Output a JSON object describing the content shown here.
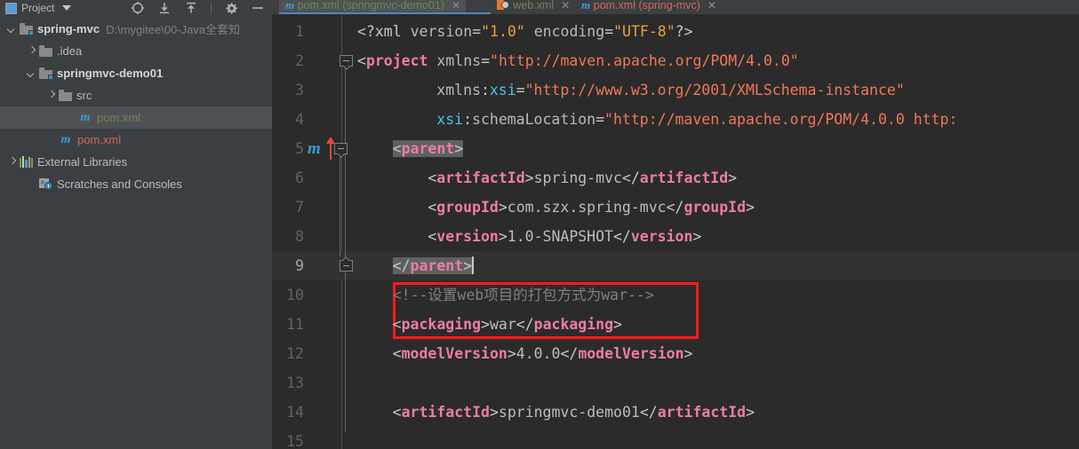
{
  "window": {
    "app": "IntelliJ IDEA",
    "theme_bg": "#2b2b2b",
    "panel_bg": "#3c3f41",
    "accent": "#4a88c7",
    "highlight_box_color": "#ff1a1a"
  },
  "project_panel": {
    "toolbar": {
      "title": "Project",
      "dropdown_icon": "chevron-down-icon",
      "icons": [
        {
          "name": "locate-target-icon",
          "tooltip": "Select Opened File"
        },
        {
          "name": "collapse-all-icon",
          "tooltip": "Collapse All"
        },
        {
          "name": "expand-all-icon",
          "tooltip": "Expand All"
        },
        {
          "name": "settings-gear-icon",
          "tooltip": "Settings"
        },
        {
          "name": "hide-minimize-icon",
          "tooltip": "Hide"
        }
      ]
    },
    "tree": [
      {
        "id": "spring-mvc",
        "label": "spring-mvc",
        "path": "D:\\mygitee\\00-Java全套知",
        "icon": "module-folder-icon",
        "arrow": "down",
        "indent": 0,
        "bold": true,
        "color": "#d6d6d6",
        "selected": false
      },
      {
        "id": "idea",
        "label": ".idea",
        "path": "",
        "icon": "folder-icon",
        "arrow": "right",
        "indent": 1,
        "bold": false,
        "color": "#bbbbbb",
        "selected": false
      },
      {
        "id": "springmvc-demo01",
        "label": "springmvc-demo01",
        "path": "",
        "icon": "module-folder-icon",
        "arrow": "down",
        "indent": 1,
        "bold": true,
        "color": "#d6d6d6",
        "selected": false
      },
      {
        "id": "src",
        "label": "src",
        "path": "",
        "icon": "folder-icon",
        "arrow": "right",
        "indent": 2,
        "bold": false,
        "color": "#bbbbbb",
        "selected": false
      },
      {
        "id": "pom-demo01",
        "label": "pom.xml",
        "path": "",
        "icon": "maven-pom-icon",
        "arrow": "none",
        "indent": 3,
        "bold": false,
        "color": "#6a8759",
        "selected": true
      },
      {
        "id": "pom-root",
        "label": "pom.xml",
        "path": "",
        "icon": "maven-pom-icon",
        "arrow": "none",
        "indent": 2,
        "bold": false,
        "color": "#d2685f",
        "selected": false
      },
      {
        "id": "external-libraries",
        "label": "External Libraries",
        "path": "",
        "icon": "books-library-icon",
        "arrow": "right",
        "indent": 0,
        "bold": false,
        "color": "#bbbbbb",
        "selected": false
      },
      {
        "id": "scratches",
        "label": "Scratches and Consoles",
        "path": "",
        "icon": "scratches-console-icon",
        "arrow": "none",
        "indent": 1,
        "bold": false,
        "color": "#bbbbbb",
        "selected": false
      }
    ]
  },
  "editor": {
    "tabs": [
      {
        "label": "pom.xml (springmvc-demo01)",
        "icon": "maven-pom-icon",
        "color": "#6a8759",
        "active": true,
        "close_icon": "close-icon",
        "close_glyph": "✕"
      },
      {
        "label": "web.xml",
        "icon": "web-descriptor-icon",
        "color": "#6a8759",
        "active": false,
        "close_icon": "close-icon",
        "close_glyph": "✕"
      },
      {
        "label": "pom.xml (spring-mvc)",
        "icon": "maven-pom-icon",
        "color": "#d2685f",
        "active": false,
        "close_icon": "close-icon",
        "close_glyph": "✕"
      }
    ],
    "gutter": {
      "line_numbers": [
        "1",
        "2",
        "3",
        "4",
        "5",
        "6",
        "7",
        "8",
        "9",
        "10",
        "11",
        "12",
        "13",
        "14",
        "15"
      ],
      "current_line": 9,
      "maven_marker": {
        "line": 5,
        "glyph": "m",
        "color": "#3d9ad6"
      },
      "change_arrow": {
        "line": 5,
        "icon": "red-up-arrow-icon",
        "color": "#e04a3f"
      },
      "fold_markers": [
        {
          "line": 2,
          "type": "collapse"
        },
        {
          "line": 5,
          "type": "collapse"
        },
        {
          "line": 9,
          "type": "fold-end"
        }
      ]
    },
    "annotation_box": {
      "color": "#ff1a1a",
      "covers_lines": [
        10,
        11
      ]
    },
    "code": [
      {
        "line": 1,
        "segments": [
          {
            "t": "<?xml ",
            "c": "punct"
          },
          {
            "t": "version",
            "c": "attr"
          },
          {
            "t": "=",
            "c": "punct"
          },
          {
            "t": "\"1.0\"",
            "c": "str"
          },
          {
            "t": " ",
            "c": "punct"
          },
          {
            "t": "encoding",
            "c": "attr"
          },
          {
            "t": "=",
            "c": "punct"
          },
          {
            "t": "\"UTF-8\"",
            "c": "str"
          },
          {
            "t": "?>",
            "c": "punct"
          }
        ]
      },
      {
        "line": 2,
        "segments": [
          {
            "t": "<",
            "c": "punct"
          },
          {
            "t": "project",
            "c": "tagname"
          },
          {
            "t": " ",
            "c": "punct"
          },
          {
            "t": "xmlns",
            "c": "attr"
          },
          {
            "t": "=",
            "c": "punct"
          },
          {
            "t": "\"http://maven.apache.org/POM/4.0.0\"",
            "c": "redstr"
          }
        ]
      },
      {
        "line": 3,
        "indent": 9,
        "segments": [
          {
            "t": "xmlns",
            "c": "attr"
          },
          {
            "t": ":",
            "c": "punct"
          },
          {
            "t": "xsi",
            "c": "ns"
          },
          {
            "t": "=",
            "c": "punct"
          },
          {
            "t": "\"http://www.w3.org/2001/XMLSchema-instance\"",
            "c": "redstr"
          }
        ]
      },
      {
        "line": 4,
        "indent": 9,
        "segments": [
          {
            "t": "xsi",
            "c": "ns"
          },
          {
            "t": ":",
            "c": "punct"
          },
          {
            "t": "schemaLocation",
            "c": "attr"
          },
          {
            "t": "=",
            "c": "punct"
          },
          {
            "t": "\"http://maven.apache.org/POM/4.0.0 http:",
            "c": "redstr"
          }
        ]
      },
      {
        "line": 5,
        "indent": 4,
        "highlight": true,
        "segments": [
          {
            "t": "<",
            "c": "punct"
          },
          {
            "t": "parent",
            "c": "tagname"
          },
          {
            "t": ">",
            "c": "punct"
          }
        ]
      },
      {
        "line": 6,
        "indent": 8,
        "segments": [
          {
            "t": "<",
            "c": "punct"
          },
          {
            "t": "artifactId",
            "c": "tagname"
          },
          {
            "t": ">",
            "c": "punct"
          },
          {
            "t": "spring-mvc",
            "c": "val"
          },
          {
            "t": "</",
            "c": "punct"
          },
          {
            "t": "artifactId",
            "c": "tagname"
          },
          {
            "t": ">",
            "c": "punct"
          }
        ]
      },
      {
        "line": 7,
        "indent": 8,
        "segments": [
          {
            "t": "<",
            "c": "punct"
          },
          {
            "t": "groupId",
            "c": "tagname"
          },
          {
            "t": ">",
            "c": "punct"
          },
          {
            "t": "com.szx.spring-mvc",
            "c": "val"
          },
          {
            "t": "</",
            "c": "punct"
          },
          {
            "t": "groupId",
            "c": "tagname"
          },
          {
            "t": ">",
            "c": "punct"
          }
        ]
      },
      {
        "line": 8,
        "indent": 8,
        "segments": [
          {
            "t": "<",
            "c": "punct"
          },
          {
            "t": "version",
            "c": "tagname"
          },
          {
            "t": ">",
            "c": "punct"
          },
          {
            "t": "1.0-SNAPSHOT",
            "c": "val"
          },
          {
            "t": "</",
            "c": "punct"
          },
          {
            "t": "version",
            "c": "tagname"
          },
          {
            "t": ">",
            "c": "punct"
          }
        ]
      },
      {
        "line": 9,
        "indent": 4,
        "highlight": true,
        "caret": true,
        "segments": [
          {
            "t": "</",
            "c": "punct"
          },
          {
            "t": "parent",
            "c": "tagname"
          },
          {
            "t": ">",
            "c": "punct"
          }
        ]
      },
      {
        "line": 10,
        "indent": 4,
        "segments": [
          {
            "t": "<!--设置web项目的打包方式为war-->",
            "c": "comment"
          }
        ]
      },
      {
        "line": 11,
        "indent": 4,
        "segments": [
          {
            "t": "<",
            "c": "punct"
          },
          {
            "t": "packaging",
            "c": "tagname"
          },
          {
            "t": ">",
            "c": "punct"
          },
          {
            "t": "war",
            "c": "val"
          },
          {
            "t": "</",
            "c": "punct"
          },
          {
            "t": "packaging",
            "c": "tagname"
          },
          {
            "t": ">",
            "c": "punct"
          }
        ]
      },
      {
        "line": 12,
        "indent": 4,
        "segments": [
          {
            "t": "<",
            "c": "punct"
          },
          {
            "t": "modelVersion",
            "c": "tagname"
          },
          {
            "t": ">",
            "c": "punct"
          },
          {
            "t": "4.0.0",
            "c": "val"
          },
          {
            "t": "</",
            "c": "punct"
          },
          {
            "t": "modelVersion",
            "c": "tagname"
          },
          {
            "t": ">",
            "c": "punct"
          }
        ]
      },
      {
        "line": 13,
        "indent": 4,
        "segments": []
      },
      {
        "line": 14,
        "indent": 4,
        "segments": [
          {
            "t": "<",
            "c": "punct"
          },
          {
            "t": "artifactId",
            "c": "tagname"
          },
          {
            "t": ">",
            "c": "punct"
          },
          {
            "t": "springmvc-demo01",
            "c": "val"
          },
          {
            "t": "</",
            "c": "punct"
          },
          {
            "t": "artifactId",
            "c": "tagname"
          },
          {
            "t": ">",
            "c": "punct"
          }
        ]
      },
      {
        "line": 15,
        "indent": 4,
        "segments": []
      }
    ]
  }
}
